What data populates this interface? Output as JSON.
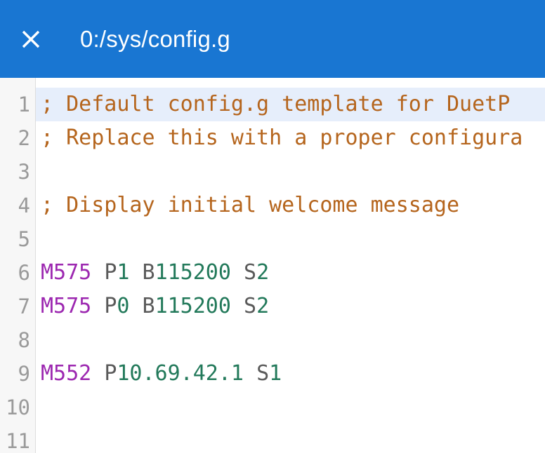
{
  "window": {
    "title": "0:/sys/config.g",
    "accent_color": "#1976d2",
    "close_icon": "close-icon"
  },
  "editor": {
    "active_line": 1,
    "active_line_color": "#e6eefb",
    "gutter_color": "#f7f7f7",
    "colors": {
      "comment": "#b5651d",
      "gcode": "#9c27b0",
      "parameter": "#5a5a5a",
      "number": "#22795a"
    },
    "lines": [
      {
        "number": "1",
        "tokens": [
          {
            "text": "; Default config.g template for DuetP",
            "type": "comment"
          }
        ]
      },
      {
        "number": "2",
        "tokens": [
          {
            "text": "; Replace this with a proper configura",
            "type": "comment"
          }
        ]
      },
      {
        "number": "3",
        "tokens": []
      },
      {
        "number": "4",
        "tokens": [
          {
            "text": "; Display initial welcome message",
            "type": "comment"
          }
        ]
      },
      {
        "number": "5",
        "tokens": []
      },
      {
        "number": "6",
        "tokens": [
          {
            "text": "M575",
            "type": "gcode"
          },
          {
            "text": " ",
            "type": "plain"
          },
          {
            "text": "P",
            "type": "parameter"
          },
          {
            "text": "1",
            "type": "number"
          },
          {
            "text": " ",
            "type": "plain"
          },
          {
            "text": "B",
            "type": "parameter"
          },
          {
            "text": "115200",
            "type": "number"
          },
          {
            "text": " ",
            "type": "plain"
          },
          {
            "text": "S",
            "type": "parameter"
          },
          {
            "text": "2",
            "type": "number"
          }
        ]
      },
      {
        "number": "7",
        "tokens": [
          {
            "text": "M575",
            "type": "gcode"
          },
          {
            "text": " ",
            "type": "plain"
          },
          {
            "text": "P",
            "type": "parameter"
          },
          {
            "text": "0",
            "type": "number"
          },
          {
            "text": " ",
            "type": "plain"
          },
          {
            "text": "B",
            "type": "parameter"
          },
          {
            "text": "115200",
            "type": "number"
          },
          {
            "text": " ",
            "type": "plain"
          },
          {
            "text": "S",
            "type": "parameter"
          },
          {
            "text": "2",
            "type": "number"
          }
        ]
      },
      {
        "number": "8",
        "tokens": []
      },
      {
        "number": "9",
        "tokens": [
          {
            "text": "M552",
            "type": "gcode"
          },
          {
            "text": " ",
            "type": "plain"
          },
          {
            "text": "P",
            "type": "parameter"
          },
          {
            "text": "10.69.42.1",
            "type": "number"
          },
          {
            "text": " ",
            "type": "plain"
          },
          {
            "text": "S",
            "type": "parameter"
          },
          {
            "text": "1",
            "type": "number"
          }
        ]
      },
      {
        "number": "10",
        "tokens": []
      },
      {
        "number": "11",
        "tokens": []
      }
    ]
  }
}
